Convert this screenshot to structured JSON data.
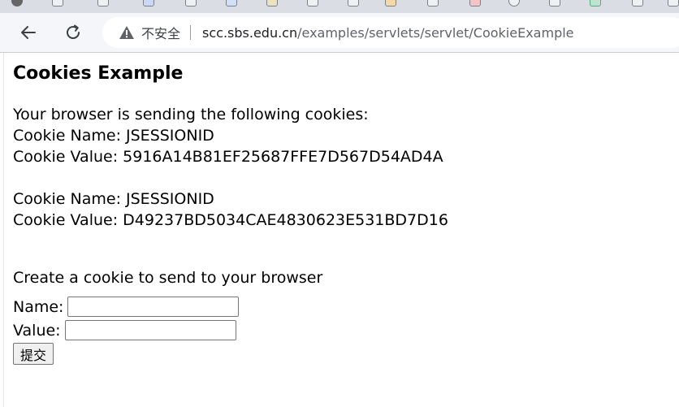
{
  "browser": {
    "security_label": "不安全",
    "url_host": "scc.sbs.edu.cn",
    "url_path": "/examples/servlets/servlet/CookieExample",
    "icons": [
      "back-arrow-icon",
      "reload-icon",
      "warning-triangle-icon"
    ]
  },
  "page": {
    "title": "Cookies Example",
    "intro": "Your browser is sending the following cookies:",
    "cookies": [
      {
        "name_line": "Cookie Name: JSESSIONID",
        "value_line": "Cookie Value: 5916A14B81EF25687FFE7D567D54AD4A"
      },
      {
        "name_line": "Cookie Name: JSESSIONID",
        "value_line": "Cookie Value: D49237BD5034CAE4830623E531BD7D16"
      }
    ],
    "create_heading": "Create a cookie to send to your browser",
    "form": {
      "name_label": "Name:",
      "name_value": "",
      "value_label": "Value:",
      "value_value": "",
      "submit_label": "提交"
    }
  }
}
